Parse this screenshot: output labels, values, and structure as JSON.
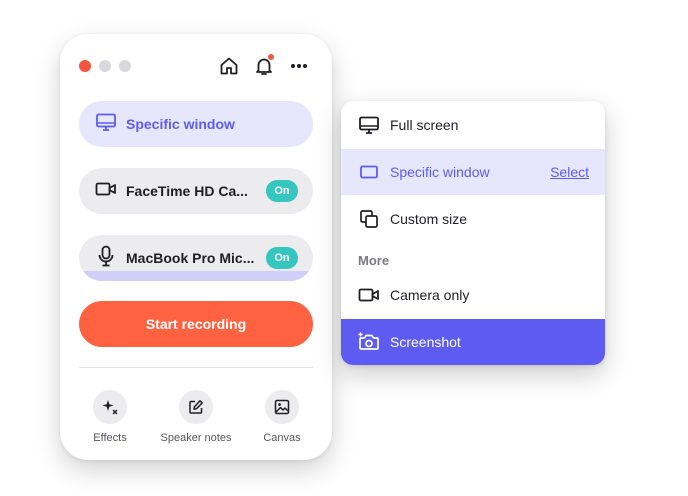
{
  "recorder": {
    "recording_source": "Specific window",
    "camera": {
      "label": "FaceTime HD Ca...",
      "toggle": "On"
    },
    "microphone": {
      "label": "MacBook Pro Mic...",
      "toggle": "On"
    },
    "start_button": "Start recording",
    "bottom_bar": [
      {
        "label": "Effects",
        "icon": "sparkle-icon"
      },
      {
        "label": "Speaker notes",
        "icon": "note-edit-icon"
      },
      {
        "label": "Canvas",
        "icon": "image-icon"
      }
    ],
    "top_icons": [
      "home-icon",
      "bell-icon",
      "more-icon"
    ]
  },
  "menu": {
    "items": [
      {
        "label": "Full screen",
        "icon": "monitor-icon"
      },
      {
        "label": "Specific window",
        "icon": "window-icon",
        "action": "Select"
      },
      {
        "label": "Custom size",
        "icon": "custom-size-icon"
      }
    ],
    "more_heading": "More",
    "more_items": [
      {
        "label": "Camera only",
        "icon": "video-camera-icon"
      },
      {
        "label": "Screenshot",
        "icon": "camera-plus-icon"
      }
    ]
  },
  "colors": {
    "accent": "#5e5cf0",
    "accent_light": "#e6e6fc",
    "record": "#ff6240",
    "toggle_on": "#34c6bf",
    "notification": "#f2563d"
  }
}
